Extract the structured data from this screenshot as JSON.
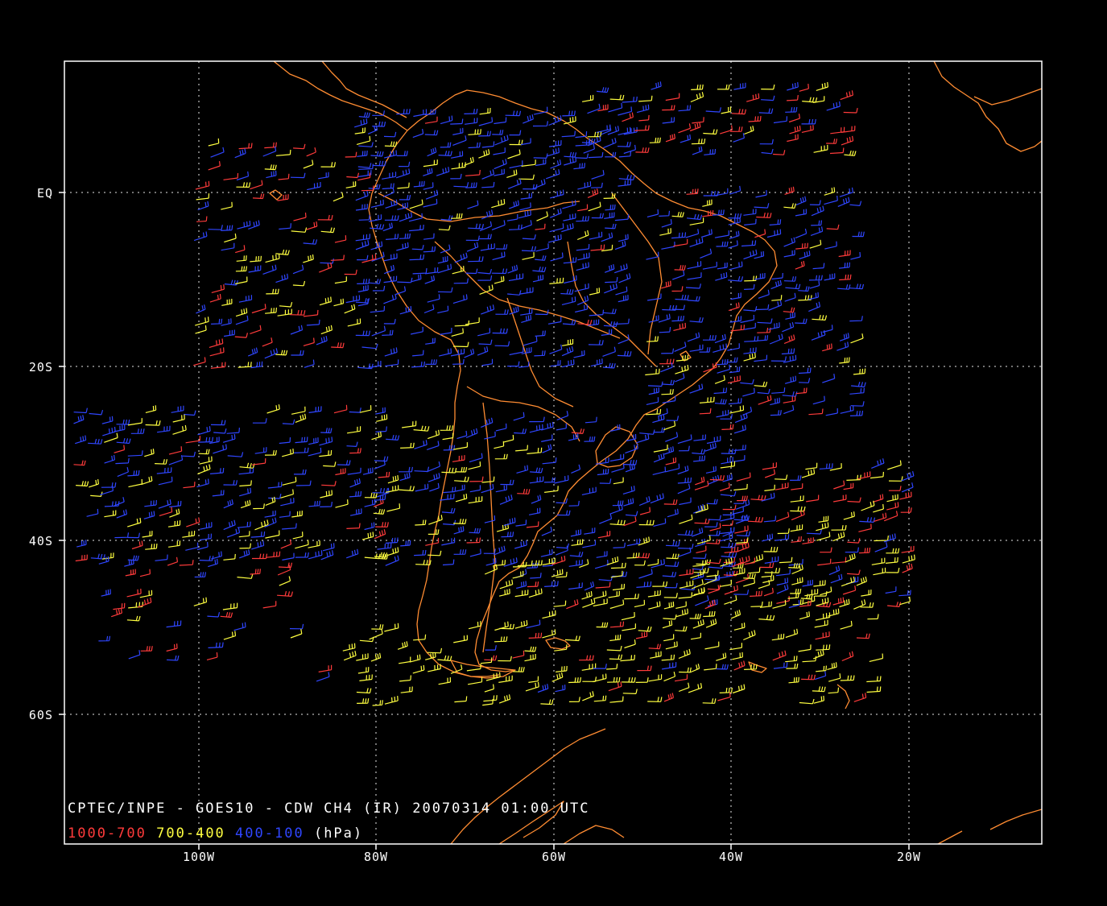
{
  "title_line": "CPTEC/INPE - GOES10 - CDW CH4 (IR) 20070314 01:00 UTC",
  "legend": {
    "items": [
      {
        "label": "1000-700",
        "color": "#ff3b3b"
      },
      {
        "label": "700-400",
        "color": "#ffff40"
      },
      {
        "label": "400-100",
        "color": "#2f46ff"
      }
    ],
    "unit": "(hPa)"
  },
  "axes": {
    "lon_labels": [
      "100W",
      "80W",
      "60W",
      "40W",
      "20W"
    ],
    "lat_labels": [
      "EQ",
      "20S",
      "40S",
      "60S"
    ]
  },
  "colors": {
    "background": "#000000",
    "frame": "#ffffff",
    "grid": "#ffffff",
    "coast": "#ff8c32",
    "low_level": "#ff3b3b",
    "mid_level": "#ffff40",
    "high_level": "#2f46ff"
  }
}
